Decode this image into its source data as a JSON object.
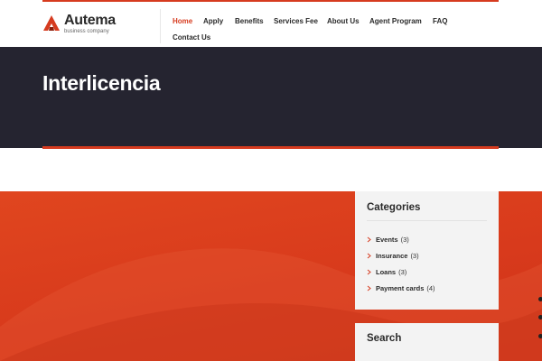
{
  "brand": {
    "name": "Autema",
    "tagline": "business company",
    "accent_color": "#d63b1f",
    "logo_icon": "autema-logo-icon"
  },
  "nav": {
    "items": [
      {
        "label": "Home",
        "active": true
      },
      {
        "label": "Apply",
        "active": false
      },
      {
        "label": "Benefits",
        "active": false
      },
      {
        "label": "Services Fee",
        "active": false
      },
      {
        "label": "About Us",
        "active": false
      },
      {
        "label": "Agent Program",
        "active": false
      },
      {
        "label": "FAQ",
        "active": false
      },
      {
        "label": "Contact Us",
        "active": false
      }
    ]
  },
  "hero": {
    "title": "Interlicencia",
    "background_color": "#252430"
  },
  "sidebar": {
    "categories": {
      "title": "Categories",
      "chevron_icon": "chevron-right-icon",
      "items": [
        {
          "name": "Events",
          "count": "(3)"
        },
        {
          "name": "Insurance",
          "count": "(3)"
        },
        {
          "name": "Loans",
          "count": "(3)"
        },
        {
          "name": "Payment cards",
          "count": "(4)"
        }
      ]
    },
    "search": {
      "title": "Search"
    }
  },
  "colors": {
    "red_section": "#d83a1c",
    "widget_bg": "#f3f3f3",
    "text_dark": "#2a2a2a"
  }
}
